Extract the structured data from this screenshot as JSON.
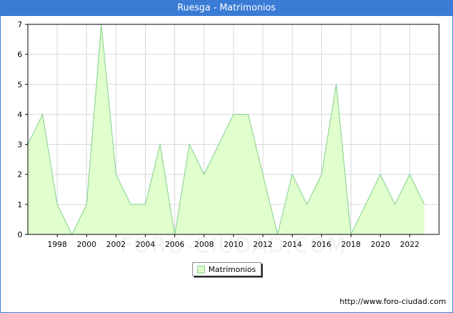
{
  "title": "Ruesga - Matrimonios",
  "footer_credit": "http://www.foro-ciudad.com",
  "watermark": "FORO-CIUDAD.COM",
  "colors": {
    "header": "#3a7bd5",
    "area_fill": "#e0ffcc",
    "area_line": "#7fcf8c",
    "grid": "#d6d6d6"
  },
  "chart_data": {
    "type": "area",
    "x": [
      1996,
      1997,
      1998,
      1999,
      2000,
      2001,
      2002,
      2003,
      2004,
      2005,
      2006,
      2007,
      2008,
      2009,
      2010,
      2011,
      2012,
      2013,
      2014,
      2015,
      2016,
      2017,
      2018,
      2019,
      2020,
      2021,
      2022,
      2023
    ],
    "series": [
      {
        "name": "Matrimonios",
        "values": [
          3,
          4,
          1,
          0,
          1,
          7,
          2,
          1,
          1,
          3,
          0,
          3,
          2,
          3,
          4,
          4,
          2,
          0,
          2,
          1,
          2,
          5,
          0,
          1,
          2,
          1,
          2,
          1
        ]
      }
    ],
    "xticks": [
      "1998",
      "2000",
      "2002",
      "2004",
      "2006",
      "2008",
      "2010",
      "2012",
      "2014",
      "2016",
      "2018",
      "2020",
      "2022"
    ],
    "yticks": [
      "0",
      "1",
      "2",
      "3",
      "4",
      "5",
      "6",
      "7"
    ],
    "xlim": [
      1996,
      2024
    ],
    "ylim": [
      0,
      7
    ],
    "grid": true,
    "legend_position": "bottom-center"
  }
}
